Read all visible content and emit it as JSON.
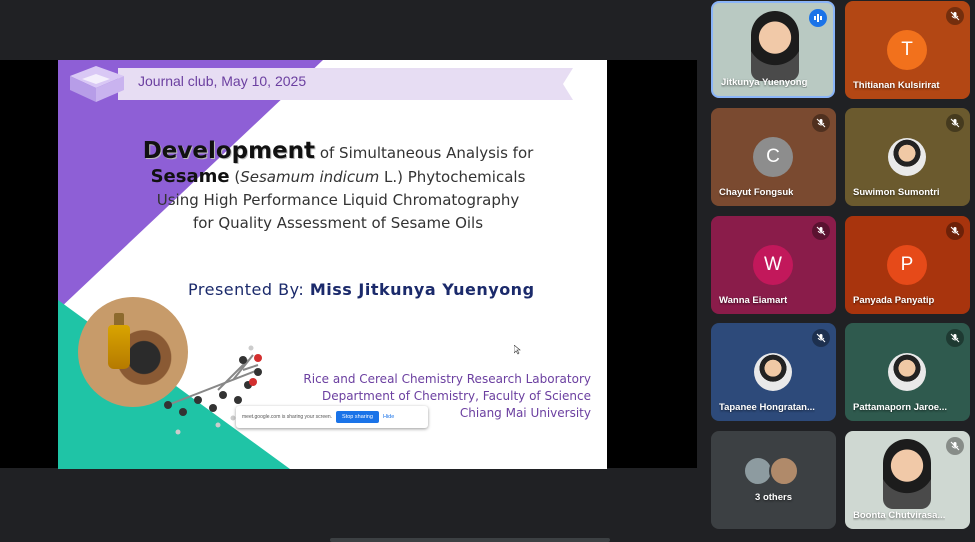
{
  "slide": {
    "header": "Journal club, May 10, 2025",
    "title_line1_big": "Development",
    "title_line1_rest": " of Simultaneous Analysis for",
    "title_line2_big": "Sesame",
    "title_line2_open": " (",
    "title_line2_italic": "Sesamum indicum",
    "title_line2_rest": " L.) Phytochemicals",
    "title_line3": "Using High Performance Liquid Chromatography",
    "title_line4": "for Quality Assessment of Sesame Oils",
    "presented_label": "Presented By: ",
    "presented_name": "Miss Jitkunya Yuenyong",
    "affil_line1": "Rice and Cereal Chemistry Research Laboratory",
    "affil_line2": "Department of Chemistry, Faculty of Science",
    "affil_line3": "Chiang Mai University"
  },
  "share_bar": {
    "message": "meet.google.com is sharing your screen.",
    "stop_label": "Stop sharing",
    "hide_label": "Hide"
  },
  "participants": [
    {
      "name": "Jitkunya Yuenyong",
      "type": "video",
      "speaking": true,
      "bg": "#b9c9c2"
    },
    {
      "name": "Thitianan Kulsirirat",
      "type": "letter",
      "letter": "T",
      "bg": "#b34714",
      "avatar": "#f2711c"
    },
    {
      "name": "Chayut Fongsuk",
      "type": "letter",
      "letter": "C",
      "bg": "#7a4a30",
      "avatar": "#8d8d8d"
    },
    {
      "name": "Suwimon Sumontri",
      "type": "photo",
      "bg": "#6b5a2e"
    },
    {
      "name": "Wanna Eiamart",
      "type": "letter",
      "letter": "W",
      "bg": "#8a1c4a",
      "avatar": "#c2185b"
    },
    {
      "name": "Panyada Panyatip",
      "type": "letter",
      "letter": "P",
      "bg": "#a8340d",
      "avatar": "#e64a19"
    },
    {
      "name": "Tapanee Hongratan...",
      "type": "photo",
      "bg": "#2d4a7a"
    },
    {
      "name": "Pattamaporn Jaroe...",
      "type": "photo",
      "bg": "#2f5a4e"
    },
    {
      "name": "3 others",
      "type": "others",
      "bg": "#3c4043"
    },
    {
      "name": "Boonta Chutvirasa...",
      "type": "video",
      "bg": "#cfd8d2"
    }
  ],
  "colors": {
    "purple": "#8e5fd6",
    "teal": "#1fc4a6",
    "banner": "#e7ddf3",
    "navy": "#1b2a6b"
  }
}
